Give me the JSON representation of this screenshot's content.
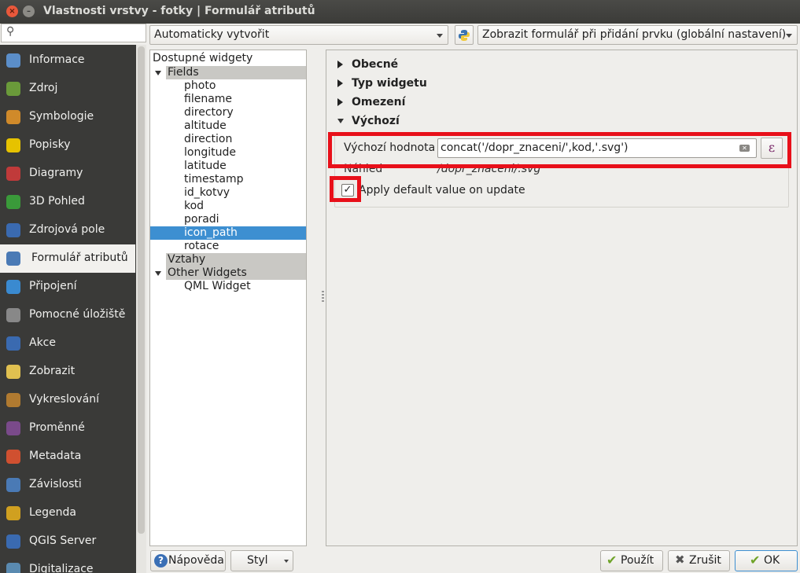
{
  "window": {
    "title": "Vlastnosti vrstvy - fotky | Formulář atributů",
    "close": "×",
    "minimize": "–"
  },
  "sidebar": {
    "search_icon": "search-icon",
    "items": [
      {
        "label": "Informace",
        "icon": "info-icon"
      },
      {
        "label": "Zdroj",
        "icon": "source-icon"
      },
      {
        "label": "Symbologie",
        "icon": "symbology-icon"
      },
      {
        "label": "Popisky",
        "icon": "labels-icon"
      },
      {
        "label": "Diagramy",
        "icon": "diagrams-icon"
      },
      {
        "label": "3D Pohled",
        "icon": "3d-view-icon"
      },
      {
        "label": "Zdrojová pole",
        "icon": "source-fields-icon"
      },
      {
        "label": "Formulář atributů",
        "icon": "attributes-form-icon",
        "active": true
      },
      {
        "label": "Připojení",
        "icon": "joins-icon"
      },
      {
        "label": "Pomocné úložiště",
        "icon": "auxiliary-storage-icon"
      },
      {
        "label": "Akce",
        "icon": "actions-icon"
      },
      {
        "label": "Zobrazit",
        "icon": "display-icon"
      },
      {
        "label": "Vykreslování",
        "icon": "rendering-icon"
      },
      {
        "label": "Proměnné",
        "icon": "variables-icon"
      },
      {
        "label": "Metadata",
        "icon": "metadata-icon"
      },
      {
        "label": "Závislosti",
        "icon": "dependencies-icon"
      },
      {
        "label": "Legenda",
        "icon": "legend-icon"
      },
      {
        "label": "QGIS Server",
        "icon": "qgis-server-icon"
      },
      {
        "label": "Digitalizace",
        "icon": "digitizing-icon"
      }
    ]
  },
  "toolbar": {
    "layout_combo": "Automaticky vytvořit",
    "show_form_combo": "Zobrazit formulář při přidání prvku (globální nastavení)"
  },
  "tree": {
    "header": "Dostupné widgety",
    "fields_group": "Fields",
    "fields": [
      "photo",
      "filename",
      "directory",
      "altitude",
      "direction",
      "longitude",
      "latitude",
      "timestamp",
      "id_kotvy",
      "kod",
      "poradi",
      "icon_path",
      "rotace"
    ],
    "selected_field": "icon_path",
    "relations_group": "Vztahy",
    "other_group": "Other Widgets",
    "other_items": [
      "QML Widget"
    ]
  },
  "details": {
    "sections": [
      "Obecné",
      "Typ widgetu",
      "Omezení",
      "Výchozí"
    ],
    "default_label": "Výchozí hodnota",
    "default_expression": "concat('/dopr_znaceni/',kod,'.svg')",
    "expression_button": "ε",
    "preview_label": "Náhled",
    "preview_value": "/dopr_znaceni/.svg",
    "apply_checkbox_label": "Apply default value on update",
    "apply_checked": true,
    "check_mark": "✓"
  },
  "buttons": {
    "help": "Nápověda",
    "style": "Styl",
    "apply": "Použít",
    "cancel": "Zrušit",
    "ok": "OK"
  },
  "colors": {
    "highlight": "#e8101a",
    "selection": "#3d8fd1",
    "sidebar_bg": "#3a3a38"
  }
}
